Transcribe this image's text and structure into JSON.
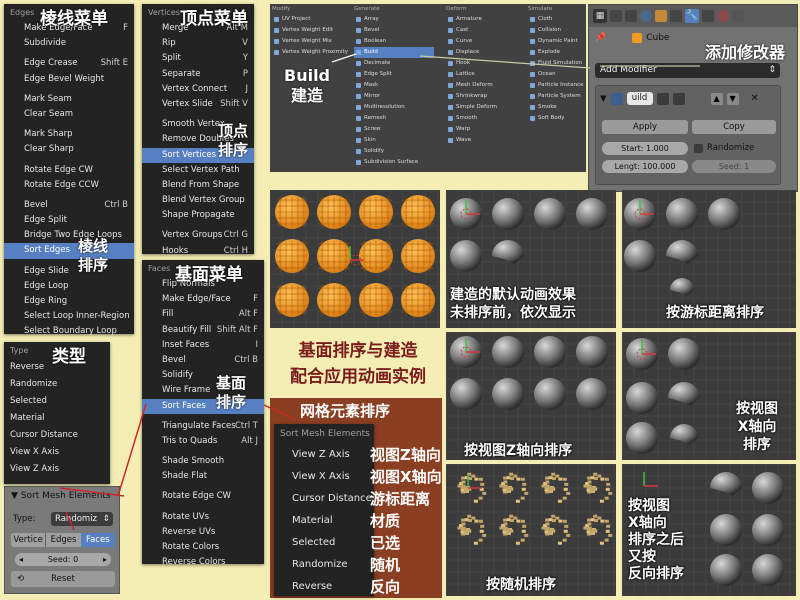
{
  "edges_menu": {
    "header": "Edges",
    "cn_title": "棱线菜单",
    "cn_sort": "棱线\n排序",
    "items": [
      {
        "label": "Make Edge/Face",
        "shortcut": "F"
      },
      {
        "label": "Subdivide",
        "shortcut": ""
      },
      {
        "label": "Edge Crease",
        "shortcut": "Shift E",
        "gap": true
      },
      {
        "label": "Edge Bevel Weight",
        "shortcut": ""
      },
      {
        "label": "Mark Seam",
        "shortcut": "",
        "gap": true
      },
      {
        "label": "Clear Seam",
        "shortcut": ""
      },
      {
        "label": "Mark Sharp",
        "shortcut": "",
        "gap": true
      },
      {
        "label": "Clear Sharp",
        "shortcut": ""
      },
      {
        "label": "Rotate Edge CW",
        "shortcut": "",
        "gap": true
      },
      {
        "label": "Rotate Edge CCW",
        "shortcut": ""
      },
      {
        "label": "Bevel",
        "shortcut": "Ctrl B",
        "gap": true
      },
      {
        "label": "Edge Split",
        "shortcut": ""
      },
      {
        "label": "Bridge Two Edge Loops",
        "shortcut": ""
      },
      {
        "label": "Sort Edges",
        "shortcut": "",
        "selected": true
      },
      {
        "label": "Edge Slide",
        "shortcut": "",
        "gap": true
      },
      {
        "label": "Edge Loop",
        "shortcut": ""
      },
      {
        "label": "Edge Ring",
        "shortcut": ""
      },
      {
        "label": "Select Loop Inner-Region",
        "shortcut": ""
      },
      {
        "label": "Select Boundary Loop",
        "shortcut": ""
      }
    ]
  },
  "vertices_menu": {
    "header": "Vertices",
    "cn_title": "顶点菜单",
    "cn_sort": "顶点\n排序",
    "items": [
      {
        "label": "Merge",
        "shortcut": "Alt M"
      },
      {
        "label": "Rip",
        "shortcut": "V"
      },
      {
        "label": "Split",
        "shortcut": "Y"
      },
      {
        "label": "Separate",
        "shortcut": "P"
      },
      {
        "label": "Vertex Connect",
        "shortcut": "J"
      },
      {
        "label": "Vertex Slide",
        "shortcut": "Shift V"
      },
      {
        "label": "Smooth Vertex",
        "shortcut": "",
        "gap": true
      },
      {
        "label": "Remove Doubles",
        "shortcut": ""
      },
      {
        "label": "Sort Vertices",
        "shortcut": "",
        "selected": true
      },
      {
        "label": "Select Vertex Path",
        "shortcut": ""
      },
      {
        "label": "Blend From Shape",
        "shortcut": ""
      },
      {
        "label": "Blend Vertex Group",
        "shortcut": ""
      },
      {
        "label": "Shape Propagate",
        "shortcut": ""
      },
      {
        "label": "Vertex Groups",
        "shortcut": "Ctrl G",
        "gap": true
      },
      {
        "label": "Hooks",
        "shortcut": "Ctrl H"
      }
    ]
  },
  "faces_menu": {
    "header": "Faces",
    "cn_title": "基面菜单",
    "cn_sort": "基面\n排序",
    "items": [
      {
        "label": "Flip Normals",
        "shortcut": ""
      },
      {
        "label": "Make Edge/Face",
        "shortcut": "F"
      },
      {
        "label": "Fill",
        "shortcut": "Alt F"
      },
      {
        "label": "Beautify Fill",
        "shortcut": "Shift Alt F"
      },
      {
        "label": "Inset Faces",
        "shortcut": "I"
      },
      {
        "label": "Bevel",
        "shortcut": "Ctrl B"
      },
      {
        "label": "Solidify",
        "shortcut": ""
      },
      {
        "label": "Wire Frame",
        "shortcut": ""
      },
      {
        "label": "Sort Faces",
        "shortcut": "",
        "selected": true
      },
      {
        "label": "Triangulate Faces",
        "shortcut": "Ctrl T",
        "gap": true
      },
      {
        "label": "Tris to Quads",
        "shortcut": "Alt J"
      },
      {
        "label": "Shade Smooth",
        "shortcut": "",
        "gap": true
      },
      {
        "label": "Shade Flat",
        "shortcut": ""
      },
      {
        "label": "Rotate Edge CW",
        "shortcut": "",
        "gap": true
      },
      {
        "label": "Rotate UVs",
        "shortcut": "",
        "gap": true
      },
      {
        "label": "Reverse UVs",
        "shortcut": ""
      },
      {
        "label": "Rotate Colors",
        "shortcut": ""
      },
      {
        "label": "Reverse Colors",
        "shortcut": ""
      }
    ]
  },
  "type_menu": {
    "header": "Type",
    "cn_title": "类型",
    "items": [
      "Reverse",
      "Randomize",
      "Selected",
      "Material",
      "Cursor Distance",
      "View X Axis",
      "View Z Axis"
    ]
  },
  "sort_panel": {
    "title": "Sort Mesh Elements",
    "type_label": "Type:",
    "type_value": "Randomiz",
    "tabs": [
      "Vertice",
      "Edges",
      "Faces"
    ],
    "seed": "Seed: 0",
    "reset": "Reset"
  },
  "sort_mesh_popup": {
    "label": "网格元素排序",
    "title": "Sort Mesh Elements",
    "items": [
      {
        "en": "View Z Axis",
        "cn": "视图Z轴向"
      },
      {
        "en": "View X Axis",
        "cn": "视图X轴向"
      },
      {
        "en": "Cursor Distance",
        "cn": "游标距离"
      },
      {
        "en": "Material",
        "cn": "材质"
      },
      {
        "en": "Selected",
        "cn": "已选"
      },
      {
        "en": "Randomize",
        "cn": "随机"
      },
      {
        "en": "Reverse",
        "cn": "反向"
      }
    ]
  },
  "modifier_menu": {
    "columns": [
      {
        "header": "Modify",
        "items": [
          "UV Project",
          "Vertex Weight Edit",
          "Vertex Weight Mix",
          "Vertex Weight Proximity"
        ]
      },
      {
        "header": "Generate",
        "items": [
          "Array",
          "Bevel",
          "Boolean",
          "Build",
          "Decimate",
          "Edge Split",
          "Mask",
          "Mirror",
          "Multiresolution",
          "Remesh",
          "Screw",
          "Skin",
          "Solidify",
          "Subdivision Surface"
        ],
        "selected": "Build"
      },
      {
        "header": "Deform",
        "items": [
          "Armature",
          "Cast",
          "Curve",
          "Displace",
          "Hook",
          "Lattice",
          "Mesh Deform",
          "Shrinkwrap",
          "Simple Deform",
          "Smooth",
          "Warp",
          "Wave"
        ]
      },
      {
        "header": "Simulate",
        "items": [
          "Cloth",
          "Collision",
          "Dynamic Paint",
          "Explode",
          "Fluid Simulation",
          "Ocean",
          "Particle Instance",
          "Particle System",
          "Smoke",
          "Soft Body"
        ]
      }
    ],
    "cn_build": "Build\n建造"
  },
  "props_panel": {
    "object_name": "Cube",
    "cn_add": "添加修改器",
    "add_modifier": "Add Modifier",
    "mod_name": "uild",
    "apply": "Apply",
    "copy": "Copy",
    "start": "Start: 1.000",
    "length": "Lengt: 100.000",
    "randomize": "Randomize",
    "seed": "Seed: 1"
  },
  "center_caption": "基面排序与建造\n配合应用动画实例",
  "viewport_captions": {
    "default": "建造的默认动画效果\n未排序前，依次显示",
    "cursor": "按游标距离排序",
    "viewz": "按视图Z轴向排序",
    "viewx": "按视图\nX轴向\n排序",
    "random": "按随机排序",
    "reverse": "按视图\nX轴向\n排序之后\n又按\n反向排序"
  },
  "colors": {
    "selection": "#5680c2",
    "menu_bg": "#232323",
    "page_bg": "#f4eeb4",
    "accent_orange": "#f29a1e"
  }
}
